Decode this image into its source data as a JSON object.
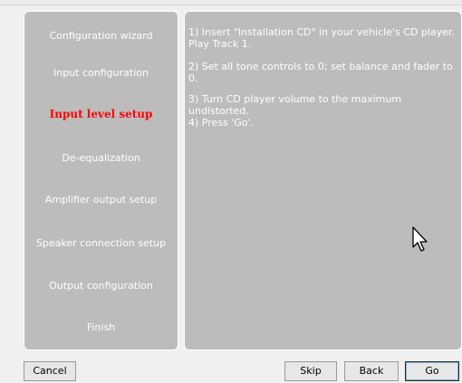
{
  "wizard": {
    "steps": [
      {
        "label": "Configuration wizard"
      },
      {
        "label": "Input configuration"
      },
      {
        "label": "Input level setup",
        "active": true
      },
      {
        "label": "De-equalization"
      },
      {
        "label": "Amplifier output setup"
      },
      {
        "label": "Speaker connection setup"
      },
      {
        "label": "Output configuration"
      },
      {
        "label": "Finish"
      }
    ],
    "instructions": {
      "line1": "1) Insert \"Installation CD\" in your vehicle's CD player.",
      "line2": "Play Track 1.",
      "line3": "2) Set all tone controls to 0; set balance and fader to 0.",
      "line4": "3) Turn CD player volume to the maximum undistorted.",
      "line5": "4) Press 'Go'."
    }
  },
  "buttons": {
    "cancel": "Cancel",
    "skip": "Skip",
    "back": "Back",
    "go": "Go"
  },
  "colors": {
    "panel_bg": "#bcbcbc",
    "active_step": "#ff0000",
    "text": "#ffffff"
  },
  "icons": {
    "cursor": "mouse-pointer-icon"
  }
}
